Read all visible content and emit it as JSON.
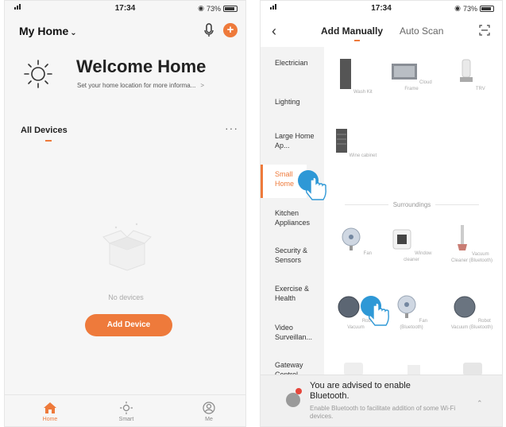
{
  "left": {
    "status_time": "17:34",
    "status_battery": "73%",
    "home_title": "My Home",
    "welcome": "Welcome Home",
    "location_hint": "Set your home location for more informa...",
    "all_devices": "All Devices",
    "no_devices": "No devices",
    "add_device": "Add Device",
    "tabs": [
      {
        "label": "Home",
        "icon": "home-icon"
      },
      {
        "label": "Smart",
        "icon": "sun-icon"
      },
      {
        "label": "Me",
        "icon": "user-icon"
      }
    ],
    "accent": "#ee7a3b"
  },
  "right": {
    "status_time": "17:34",
    "status_battery": "73%",
    "tabs": {
      "manual": "Add Manually",
      "auto": "Auto Scan"
    },
    "categories": [
      "Electrician",
      "Lighting",
      "Large Home Ap...",
      "Small Home",
      "Kitchen Appliances",
      "Security & Sensors",
      "Exercise & Health",
      "Video Surveillan...",
      "Gateway Control"
    ],
    "selected_category": "Small Home",
    "devices_top": [
      "Wash Kit",
      "Cloud Frame",
      "TRV",
      "Wine cabinet"
    ],
    "section": "Surroundings",
    "devices_surroundings": [
      "Fan",
      "Window cleaner",
      "Vacuum Cleaner (Bluetooth)",
      "Robot Vacuum",
      "Fan (Bluetooth)",
      "Robot Vacuum (Bluetooth)"
    ],
    "bluetooth_title": "You are advised to enable Bluetooth.",
    "bluetooth_desc": "Enable Bluetooth to facilitate addition of some Wi-Fi devices."
  }
}
